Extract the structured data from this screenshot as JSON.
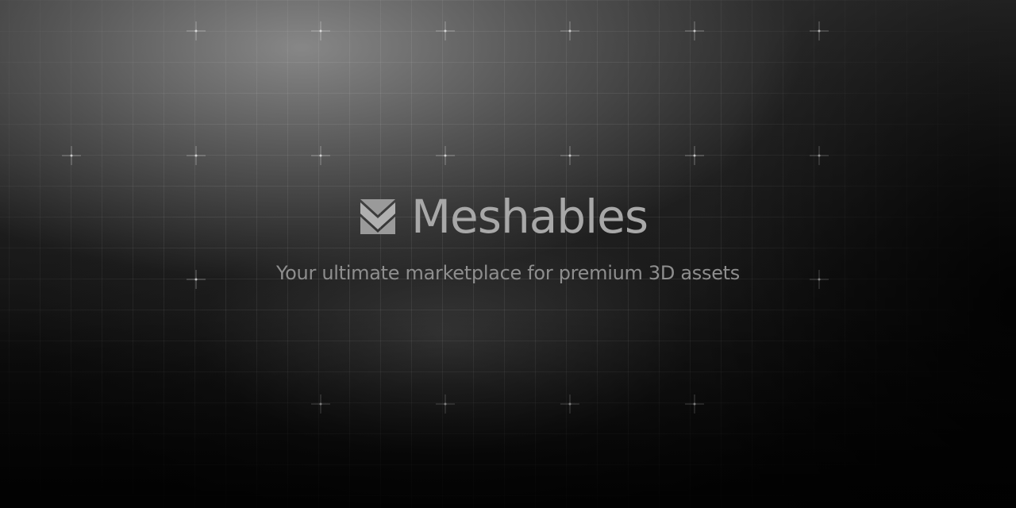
{
  "brand": {
    "name": "Meshables",
    "tagline": "Your ultimate marketplace for premium 3D assets",
    "logo_icon": "chevron-stack-icon"
  },
  "colors": {
    "text_primary": "#a8a8a8",
    "text_secondary": "#8e8e8e",
    "background": "#000000"
  }
}
